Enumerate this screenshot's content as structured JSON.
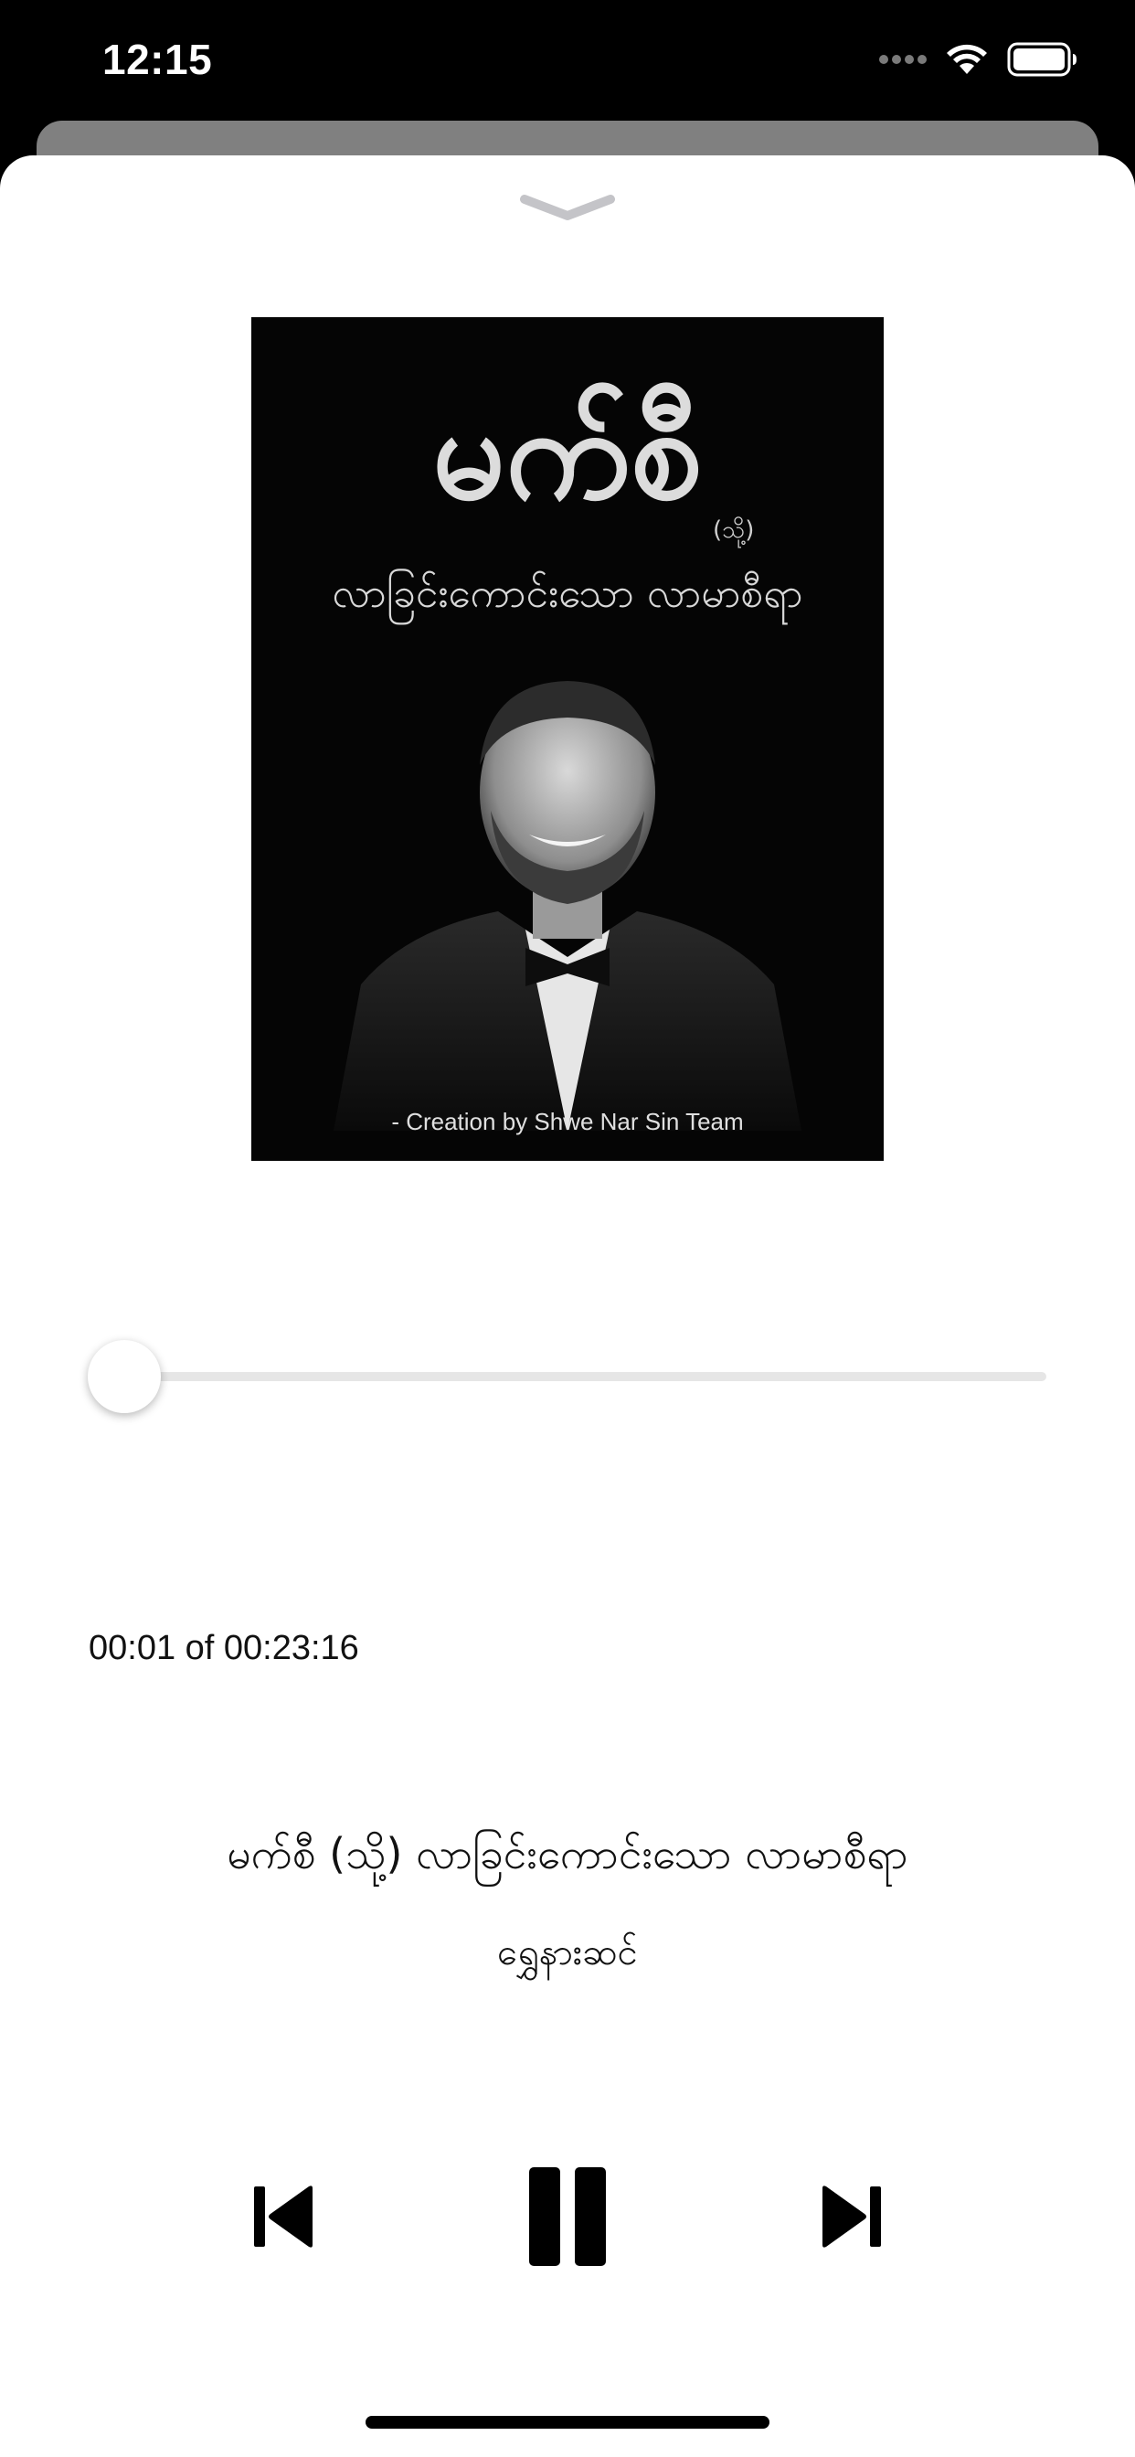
{
  "status_bar": {
    "time": "12:15",
    "icons": [
      "signal-dots-icon",
      "wifi-icon",
      "battery-icon"
    ]
  },
  "cover": {
    "title_large": "မက်စီ",
    "title_small": "(သို့)",
    "subtitle": "လာခြင်းကောင်းသော လာမာစီရာ",
    "credit": "- Creation by Shwe Nar Sin Team"
  },
  "player": {
    "progress_fraction": 0.0007,
    "time_readout": "00:01 of 00:23:16",
    "title": "မက်စီ (သို့) လာခြင်းကောင်းသော လာမာစီရာ",
    "artist": "ရွှေနားဆင်"
  },
  "controls": {
    "icons": [
      "previous-track-icon",
      "pause-icon",
      "next-track-icon"
    ]
  },
  "colors": {
    "background": "#ffffff",
    "status_bar": "#000000",
    "track": "#e6e6e6",
    "icon": "#000000"
  }
}
